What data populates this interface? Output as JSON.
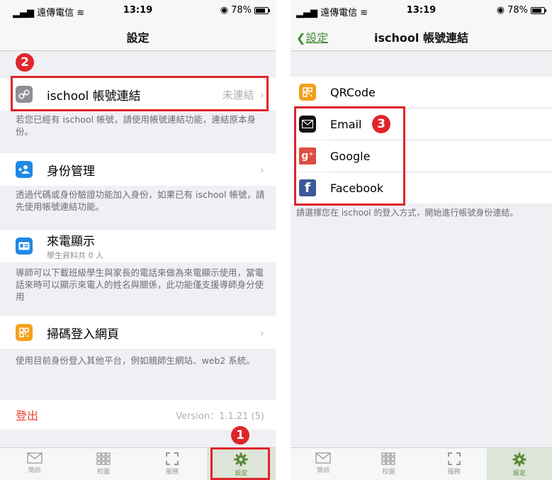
{
  "status_bar": {
    "carrier": "遠傳電信",
    "time": "13:19",
    "battery": "78%"
  },
  "left": {
    "title": "設定",
    "ischool": {
      "label": "ischool 帳號連結",
      "value": "未連結"
    },
    "ischool_note": "若您已經有 ischool 帳號，請使用帳號連結功能，連結原本身份。",
    "identity": {
      "label": "身份管理"
    },
    "identity_note": "透過代碼或身份驗證功能加入身份，如果已有 ischool 帳號，請先使用帳號連結功能。",
    "caller": {
      "label": "來電顯示",
      "sub": "學生資料共 0 人"
    },
    "caller_note": "導師可以下載班級學生與家長的電話來做為來電顯示使用，當電話來時可以顯示來電人的姓名與關係，此功能僅支援導師身分使用",
    "scan": {
      "label": "掃碼登入網頁"
    },
    "scan_note": "使用目前身份登入其他平台，例如親師生網站、web2 系統。",
    "logout": "登出",
    "version": "Version：1.1.21 (5)"
  },
  "right": {
    "back": "設定",
    "title": "ischool 帳號連結",
    "items": [
      {
        "label": "QRCode"
      },
      {
        "label": "Email"
      },
      {
        "label": "Google"
      },
      {
        "label": "Facebook"
      }
    ],
    "note": "請選擇您在 ischool 的登入方式，開始進行帳號身份連結。"
  },
  "tabs": [
    {
      "label": "簡訊",
      "icon": "envelope-icon"
    },
    {
      "label": "校園",
      "icon": "grid-icon"
    },
    {
      "label": "服務",
      "icon": "scan-icon"
    },
    {
      "label": "設定",
      "icon": "gear-icon"
    }
  ],
  "badges": {
    "one": "1",
    "two": "2",
    "three": "3"
  },
  "colors": {
    "accent_green": "#3c8a2e",
    "highlight_red": "#e0242a",
    "logout_red": "#e8412c"
  }
}
